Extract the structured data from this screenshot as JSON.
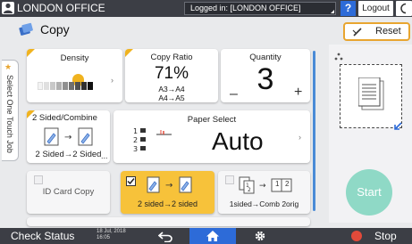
{
  "topbar": {
    "office": "LONDON OFFICE",
    "login_status": "Logged in: [LONDON OFFICE]",
    "help_label": "?",
    "logout_label": "Logout"
  },
  "title": "Copy",
  "reset_label": "Reset",
  "side_tab_label": "Select One Touch Job",
  "density": {
    "label": "Density"
  },
  "copy_ratio": {
    "label": "Copy Ratio",
    "value": "71%",
    "line1": "A3→A4",
    "line2": "A4→A5"
  },
  "quantity": {
    "label": "Quantity",
    "value": "3",
    "minus": "–",
    "plus": "+"
  },
  "sided": {
    "label": "2 Sided/Combine",
    "mode": "2 Sided→2 Sided",
    "more": "..."
  },
  "paper_select": {
    "label": "Paper Select",
    "value": "Auto",
    "trays": [
      "1",
      "2",
      "3"
    ]
  },
  "id_card": {
    "label": "ID Card Copy"
  },
  "preset_2sided": {
    "label": "2 sided→2 sided"
  },
  "preset_comb": {
    "label": "1sided→Comb 2orig",
    "box1": "1",
    "box2": "2"
  },
  "start_label": "Start",
  "bottombar": {
    "check_status": "Check Status",
    "date": "18 Jul, 2018",
    "time": "16:05",
    "stop_label": "Stop"
  },
  "colors": {
    "accent": "#f0b31f",
    "bar": "#3c3e45",
    "home": "#2d6bd8",
    "start": "#8fd9c6",
    "stop": "#e24a3a"
  }
}
